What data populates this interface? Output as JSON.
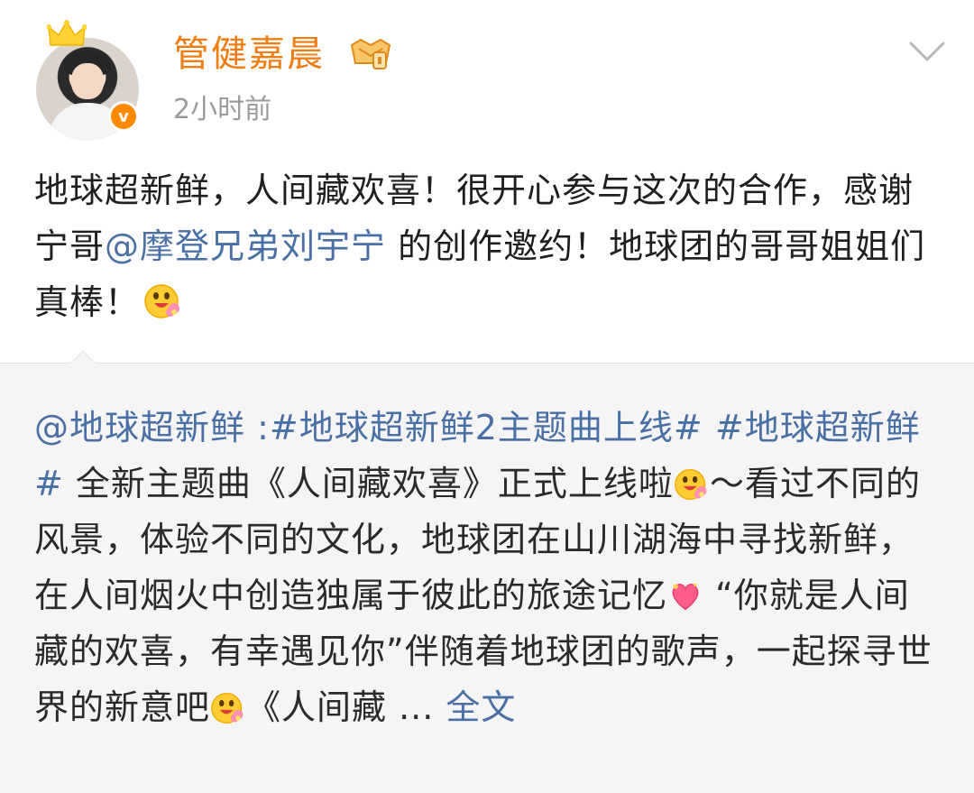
{
  "author": {
    "name": "管健嘉晨",
    "time": "2小时前",
    "verified_mark": "v",
    "icons": [
      "crown-icon",
      "vip-level-badge-icon",
      "verified-badge-icon",
      "chevron-down-icon"
    ]
  },
  "post": {
    "text_before_mention": "地球超新鲜，人间藏欢喜！很开心参与这次的合作，感谢宁哥",
    "mention": "@摩登兄弟刘宇宁",
    "text_after_mention": " 的创作邀约！地球团的哥哥姐姐们真棒！",
    "emoji": "hug-emoji"
  },
  "repost": {
    "mention": "@地球超新鲜",
    "separator": " :",
    "hashtag1": "#地球超新鲜2主题曲上线#",
    "hashtag2": "#地球超新鲜#",
    "text1": " 全新主题曲《人间藏欢喜》正式上线啦",
    "text2": "～看过不同的风景，体验不同的文化，地球团在山川湖海中寻找新鲜，在人间烟火中创造独属于彼此的旅途记忆",
    "text3": " “你就是人间藏的欢喜，有幸遇见你”伴随着地球团的歌声，一起探寻世界的新意吧",
    "text4": "《人间藏 ... ",
    "full_text_link": "全文",
    "emojis": [
      "hug-emoji",
      "heart-emoji"
    ]
  },
  "colors": {
    "username": "#f07d12",
    "link": "#4a6fa5",
    "time": "#9a9a9a",
    "repost_bg": "#f5f5f5"
  }
}
